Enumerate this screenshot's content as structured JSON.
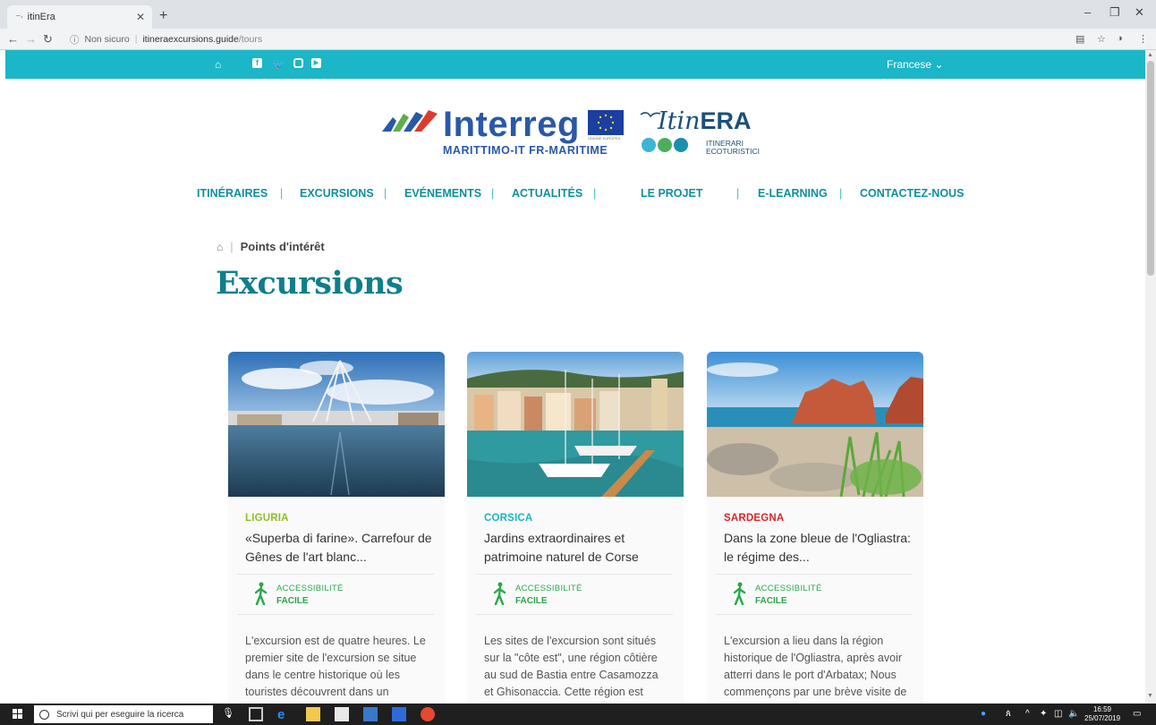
{
  "browser": {
    "tab_title": "itinEra",
    "tab_favicon": "itinera-favicon-icon",
    "new_tab": "+",
    "security_label": "Non sicuro",
    "url_host": "itineraexcursions.guide",
    "url_path": "/tours"
  },
  "topbar": {
    "background": "#1bb6c8",
    "language": "Francese ⌄",
    "social_icons": [
      "home-icon",
      "facebook-icon",
      "twitter-icon",
      "instagram-icon",
      "youtube-icon"
    ]
  },
  "logos": {
    "interreg_word": "Interreg",
    "interreg_sub": "MARITTIMO-IT FR-MARITIME",
    "eu_caption": "UNIONE EUROPEA",
    "itinera_prefix": "Itin",
    "itinera_suffix": "ERA",
    "itinera_sub_line1": "ITINERARI",
    "itinera_sub_line2": "ECOTURISTICI"
  },
  "nav": {
    "items": [
      "ITINÉRAIRES",
      "EXCURSIONS",
      "EVÉNEMENTS",
      "ACTUALITÉS",
      "LE PROJET",
      "E-LEARNING",
      "CONTACTEZ-NOUS"
    ]
  },
  "breadcrumb": {
    "current": "Points d'intérêt"
  },
  "page": {
    "title": "Excursions"
  },
  "cards": [
    {
      "region": "LIGURIA",
      "region_color": "#8cbf26",
      "title": "«Superba di farine». Carrefour de Gênes de l'art blanc...",
      "access_label": "ACCESSIBILITÉ",
      "access_value": "FACILE",
      "description": "L'excursion est de quatre heures. Le premier site de l'excursion se situe dans le centre historique où les touristes découvrent dans un laboratoire contemporain les"
    },
    {
      "region": "CORSICA",
      "region_color": "#1bb6c8",
      "title": "Jardins extraordinaires et patrimoine naturel de Corse",
      "access_label": "ACCESSIBILITÉ",
      "access_value": "FACILE",
      "description": "Les sites de l'excursion sont situés sur la \"côte est\", une région côtière au sud de Bastia entre Casamozza et Ghisonaccia. Cette région est traditionnellement une région"
    },
    {
      "region": "SARDEGNA",
      "region_color": "#d9262c",
      "title": "Dans la zone bleue de l'Ogliastra: le régime des...",
      "access_label": "ACCESSIBILITÉ",
      "access_value": "FACILE",
      "description": "L'excursion a lieu dans la région historique de l'Ogliastra, après avoir atterri dans le port d'Arbatax; Nous commençons par une brève visite de la ville de Lanusei et du"
    }
  ],
  "taskbar": {
    "search_placeholder": "Scrivi qui per eseguire la ricerca",
    "time": "16:59",
    "date": "25/07/2019"
  }
}
